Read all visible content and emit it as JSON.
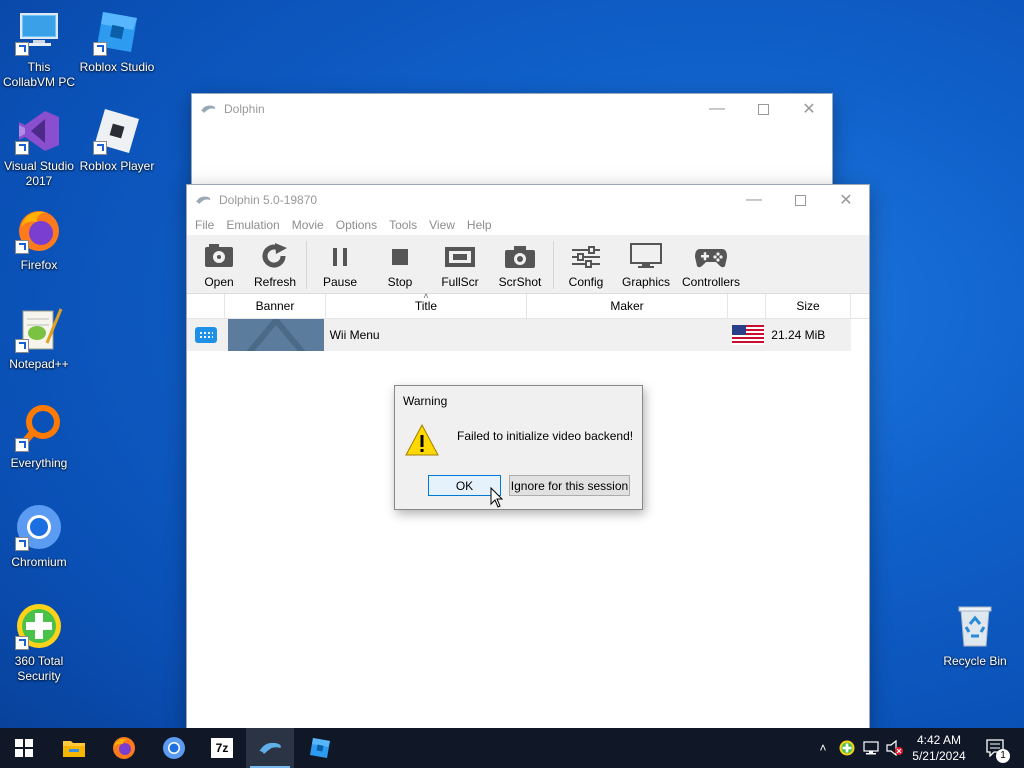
{
  "desktop": {
    "icons": [
      {
        "label": "This CollabVM PC"
      },
      {
        "label": "Roblox Studio"
      },
      {
        "label": "Visual Studio 2017"
      },
      {
        "label": "Roblox Player"
      },
      {
        "label": "Firefox"
      },
      {
        "label": "Notepad++"
      },
      {
        "label": "Everything"
      },
      {
        "label": "Chromium"
      },
      {
        "label": "360 Total Security"
      },
      {
        "label": "Recycle Bin"
      }
    ]
  },
  "bg_window": {
    "title": "Dolphin"
  },
  "main_window": {
    "title": "Dolphin 5.0-19870",
    "menu": [
      "File",
      "Emulation",
      "Movie",
      "Options",
      "Tools",
      "View",
      "Help"
    ],
    "toolbar": {
      "open": "Open",
      "refresh": "Refresh",
      "pause": "Pause",
      "stop": "Stop",
      "fullscr": "FullScr",
      "scrshot": "ScrShot",
      "config": "Config",
      "graphics": "Graphics",
      "controllers": "Controllers"
    },
    "columns": {
      "banner": "Banner",
      "title": "Title",
      "maker": "Maker",
      "size": "Size"
    },
    "games": [
      {
        "title": "Wii Menu",
        "maker": "",
        "size": "21.24 MiB",
        "region_flag": "usa-flag-icon",
        "platform_icon": "wii-icon"
      }
    ]
  },
  "dialog": {
    "title": "Warning",
    "message": "Failed to initialize video backend!",
    "ok": "OK",
    "ignore": "Ignore for this session",
    "icon": "warning-icon"
  },
  "taskbar": {
    "time": "4:42 AM",
    "date": "5/21/2024",
    "notification_count": "1",
    "apps": [
      "start",
      "file-explorer",
      "firefox",
      "chromium",
      "7zip",
      "dolphin",
      "roblox-studio"
    ]
  },
  "colors": {
    "desktop_bg": "#0f5fc8",
    "taskbar_bg": "#101828",
    "accent": "#0078d7"
  }
}
